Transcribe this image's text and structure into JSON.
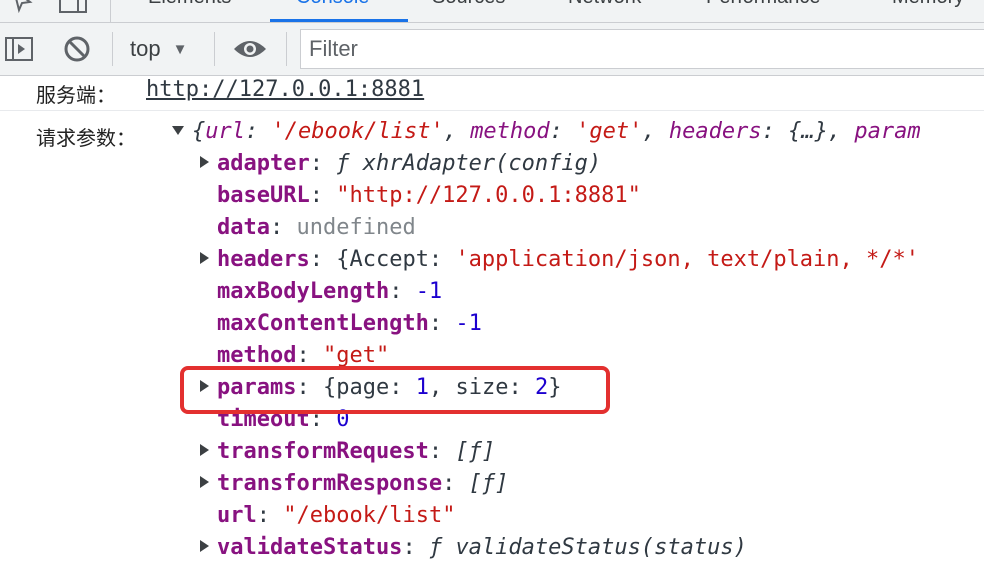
{
  "tabs": [
    {
      "label": "Elements",
      "active": false
    },
    {
      "label": "Console",
      "active": true
    },
    {
      "label": "Sources",
      "active": false
    },
    {
      "label": "Network",
      "active": false
    },
    {
      "label": "Performance",
      "active": false
    },
    {
      "label": "Memory",
      "active": false
    }
  ],
  "toolbar": {
    "context": "top",
    "filter_placeholder": "Filter"
  },
  "icons": [
    "inspect-icon",
    "device-toggle-icon",
    "sidebar-toggle-icon",
    "clear-console-icon",
    "eye-icon",
    "chevron-down-icon"
  ],
  "colors": {
    "highlight": "#e3302f",
    "active_tab": "#1a73e8"
  },
  "log1": {
    "label": "服务端：",
    "value": "http://127.0.0.1:8881"
  },
  "log2": {
    "label": "请求参数：",
    "summary": {
      "open": "{",
      "k1": "url",
      "v1": "'/ebook/list'",
      "k2": "method",
      "v2": "'get'",
      "k3": "headers",
      "v3": "{…}",
      "k4": "param"
    },
    "props": {
      "adapter": {
        "key": "adapter",
        "f": "ƒ",
        "value": "xhrAdapter(config)"
      },
      "baseURL": {
        "key": "baseURL",
        "value": "\"http://127.0.0.1:8881\""
      },
      "data": {
        "key": "data",
        "value": "undefined"
      },
      "headers": {
        "key": "headers",
        "open": "{Accept: ",
        "value": "'application/json, text/plain, */*'"
      },
      "maxBodyLength": {
        "key": "maxBodyLength",
        "value": "-1"
      },
      "maxContentLength": {
        "key": "maxContentLength",
        "value": "-1"
      },
      "method": {
        "key": "method",
        "value": "\"get\""
      },
      "params": {
        "key": "params",
        "k1": "page",
        "v1": "1",
        "k2": "size",
        "v2": "2"
      },
      "timeout": {
        "key": "timeout",
        "value": "0"
      },
      "transformRequest": {
        "key": "transformRequest",
        "value": "[ƒ]"
      },
      "transformResponse": {
        "key": "transformResponse",
        "value": "[ƒ]"
      },
      "url": {
        "key": "url",
        "value": "\"/ebook/list\""
      },
      "validateStatus": {
        "key": "validateStatus",
        "f": "ƒ",
        "value": "validateStatus(status)"
      }
    }
  }
}
